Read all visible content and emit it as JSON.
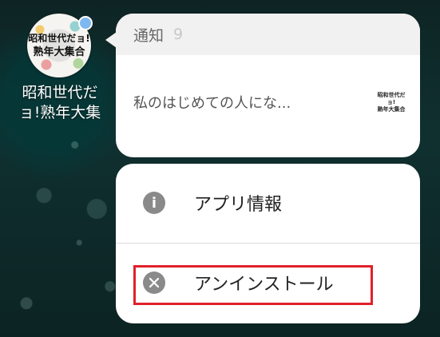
{
  "app": {
    "icon_name": "app-logo-icon",
    "logo_line1": "昭和世代だョ!",
    "logo_line2": "熟年大集合",
    "label_line1": "昭和世代だ",
    "label_line2": "ョ!熟年大集"
  },
  "notification": {
    "title": "通知",
    "count": "9",
    "preview": "私のはじめての人にな...",
    "thumb_line1": "昭和世代だョ!",
    "thumb_line2": "熟年大集合"
  },
  "menu": {
    "items": [
      {
        "label": "アプリ情報",
        "icon": "info-icon"
      },
      {
        "label": "アンインストール",
        "icon": "close-circle-icon"
      }
    ]
  },
  "colors": {
    "highlight": "#e0202b",
    "badge": "#7fb8f0"
  }
}
